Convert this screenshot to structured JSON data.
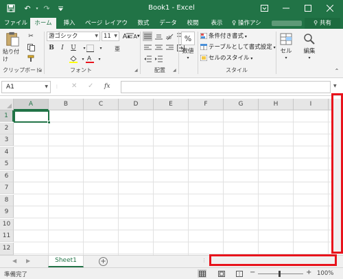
{
  "window": {
    "title": "Book1 - Excel"
  },
  "tabs": [
    {
      "label": "ファイル",
      "active": false
    },
    {
      "label": "ホーム",
      "active": true
    },
    {
      "label": "挿入",
      "active": false
    },
    {
      "label": "ページ レイアウト",
      "active": false
    },
    {
      "label": "数式",
      "active": false
    },
    {
      "label": "データ",
      "active": false
    },
    {
      "label": "校閲",
      "active": false
    },
    {
      "label": "表示",
      "active": false
    }
  ],
  "tell_me": "操作アシ",
  "share": "共有",
  "ribbon": {
    "clipboard": {
      "paste": "貼り付け",
      "label": "クリップボード"
    },
    "font": {
      "name": "游ゴシック",
      "size": "11",
      "label": "フォント"
    },
    "alignment": {
      "label": "配置"
    },
    "number": {
      "button": "数値",
      "symbol": "%"
    },
    "styles": {
      "conditional": "条件付き書式",
      "table": "テーブルとして書式設定",
      "cell_styles": "セルのスタイル",
      "label": "スタイル"
    },
    "cells": {
      "button": "セル"
    },
    "editing": {
      "button": "編集"
    }
  },
  "formula_bar": {
    "name_box": "A1",
    "fx": "fx",
    "value": ""
  },
  "grid": {
    "columns": [
      "A",
      "B",
      "C",
      "D",
      "E",
      "F",
      "G",
      "H",
      "I"
    ],
    "rows": [
      "1",
      "2",
      "3",
      "4",
      "5",
      "6",
      "7",
      "8",
      "9",
      "10",
      "11",
      "12"
    ],
    "selected_cell": "A1"
  },
  "sheets": [
    {
      "name": "Sheet1",
      "active": true
    }
  ],
  "status": {
    "text": "準備完了",
    "zoom": "100%",
    "zoom_level": 100
  },
  "colors": {
    "accent": "#217346",
    "highlight": "#e8121b"
  }
}
